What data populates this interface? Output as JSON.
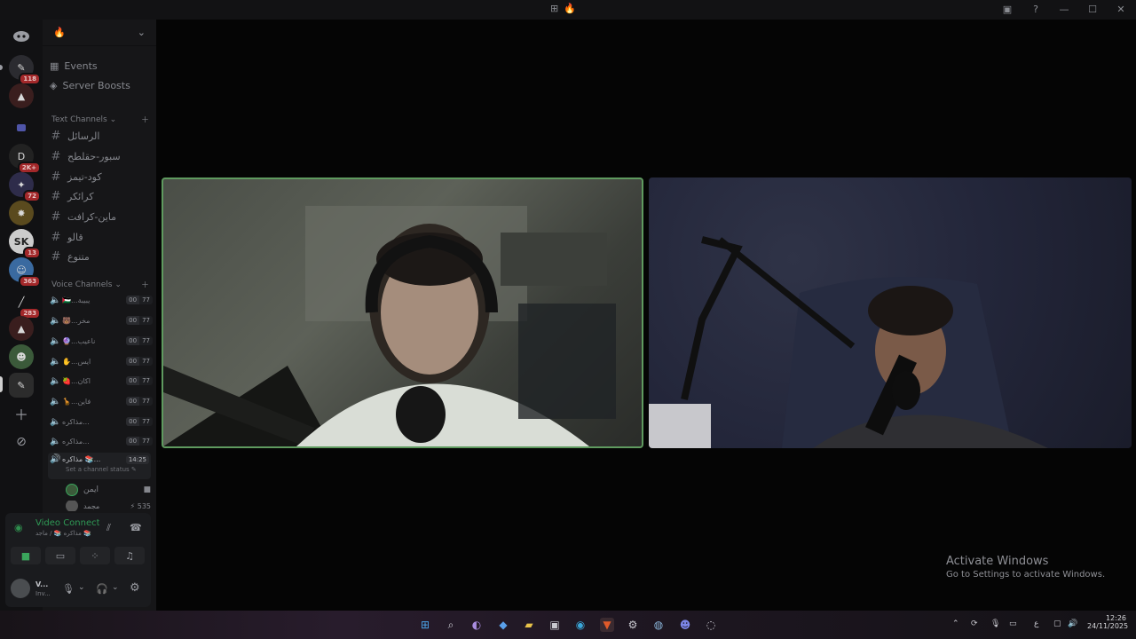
{
  "titlebar": {
    "center_icons": [
      "crosshair-icon",
      "flame-icon"
    ],
    "flame_glyph": "🔥"
  },
  "rail": {
    "badges": [
      "118",
      "2K+",
      "72",
      "13",
      "363",
      "283"
    ]
  },
  "sidebar": {
    "server_name_glyph": "🔥",
    "events": "Events",
    "boosts": "Server Boosts",
    "text_category": "Text Channels",
    "text_channels": [
      "الرسائل",
      "سبور-حقلطح",
      "كود-تيمز",
      "كرائكر",
      "ماين-كرافت",
      "قالو",
      "متنوع"
    ],
    "voice_category": "Voice Channels",
    "voice_channels": [
      {
        "name": "🇵🇸...يبيبة",
        "a": "00",
        "b": "77"
      },
      {
        "name": "🐻...مخر",
        "a": "00",
        "b": "77"
      },
      {
        "name": "🔮...ناعيب",
        "a": "00",
        "b": "77"
      },
      {
        "name": "✋...ايس",
        "a": "00",
        "b": "77"
      },
      {
        "name": "🍓...اكان",
        "a": "00",
        "b": "77"
      },
      {
        "name": "🦒...فاين",
        "a": "00",
        "b": "77"
      },
      {
        "name": "مذاكره...",
        "a": "00",
        "b": "77"
      },
      {
        "name": "مذاكره...",
        "a": "00",
        "b": "77"
      }
    ],
    "active_channel": {
      "name": "مذاكره 📚...",
      "time": "14:25",
      "status": "Set a channel status"
    },
    "members": [
      {
        "name": "ايمن"
      },
      {
        "name": "مجمد",
        "extra": "⚡ 535"
      }
    ]
  },
  "voice_panel": {
    "title": "Video Connected",
    "subtitle": "مذاكره 📚 / ماجد 📚"
  },
  "user": {
    "name": "V...",
    "status": "Inv..."
  },
  "watermark": {
    "title": "Activate Windows",
    "subtitle": "Go to Settings to activate Windows."
  },
  "taskbar": {
    "time": "12:26",
    "date": "24/11/2025",
    "lang": "ع"
  }
}
